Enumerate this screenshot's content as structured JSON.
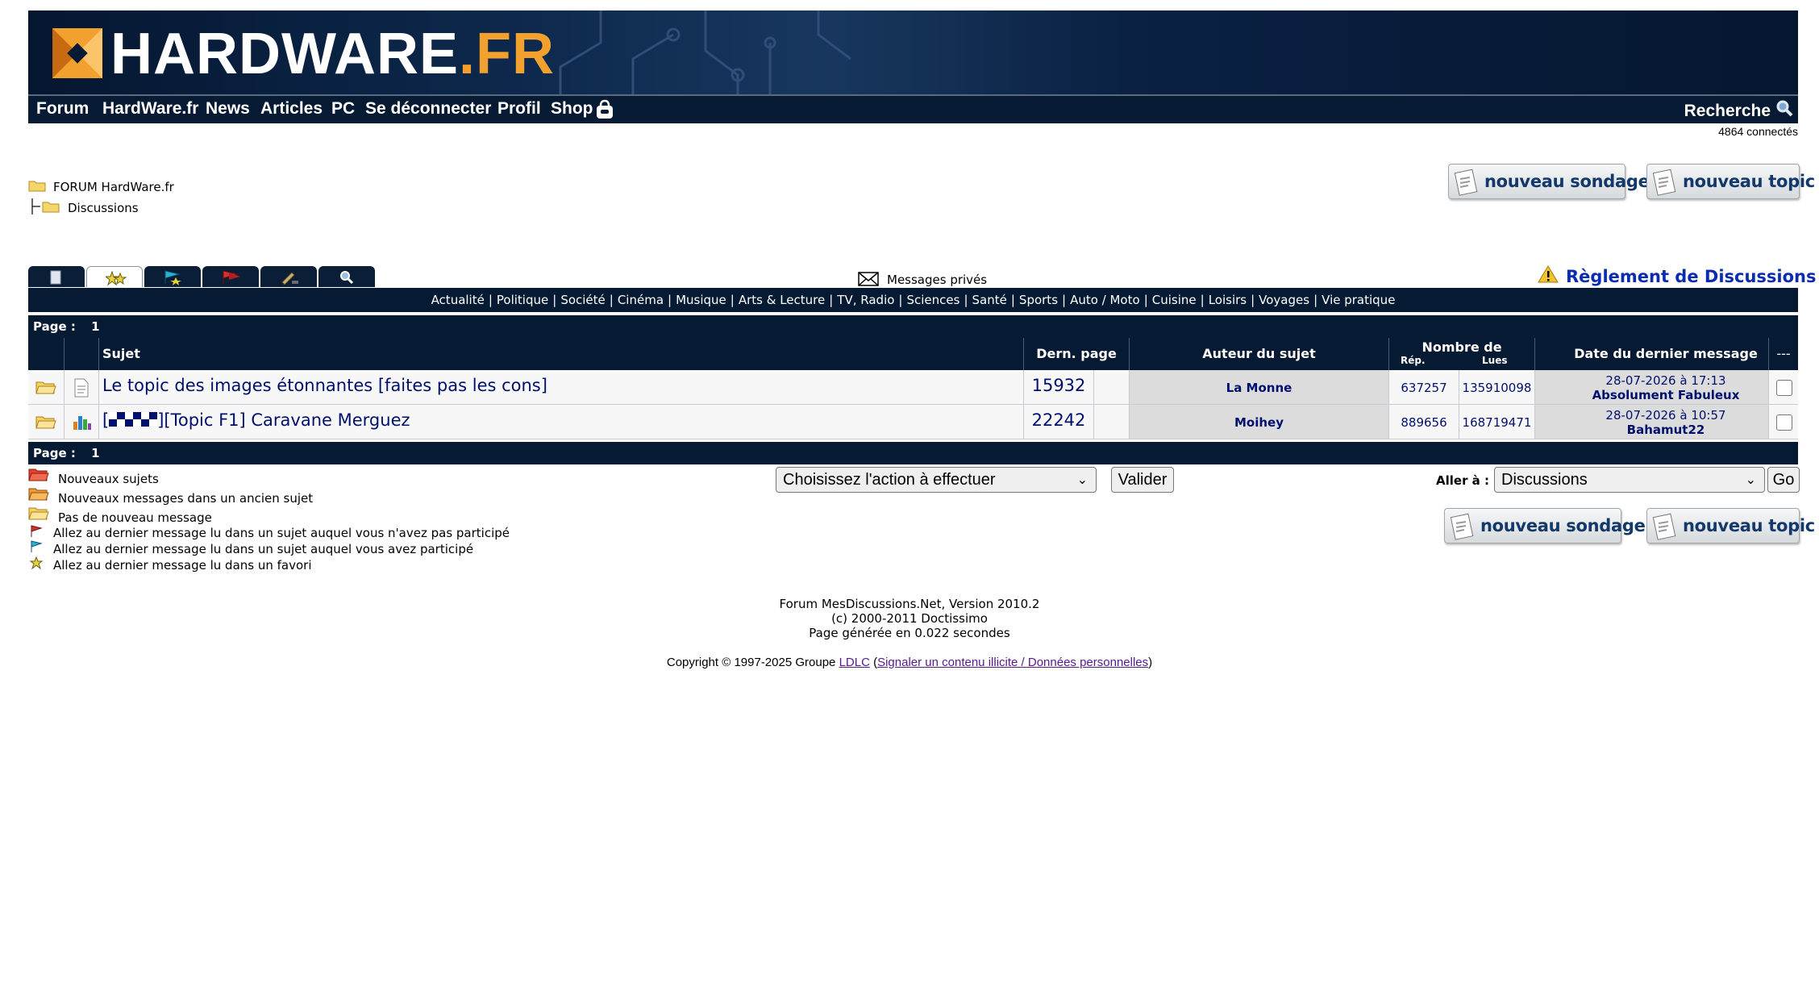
{
  "header": {
    "logo_main": "HARDWARE",
    "logo_suffix": ".FR",
    "nav": [
      "Forum",
      "HardWare.fr",
      "News",
      "Articles",
      "PC",
      "Se déconnecter",
      "Profil",
      "Shop"
    ],
    "search_label": "Recherche",
    "connected": "4864 connectés"
  },
  "breadcrumb": {
    "root": "FORUM HardWare.fr",
    "child": "Discussions"
  },
  "buttons": {
    "new_poll": "nouveau sondage",
    "new_topic": "nouveau topic"
  },
  "toolbar": {
    "private_messages": "Messages privés",
    "rules_link": "Règlement de Discussions",
    "tab_icons": [
      "page-icon",
      "stars-icon",
      "blue-flag-icon",
      "red-flag-icon",
      "pen-icon",
      "magnifier-icon"
    ]
  },
  "categories": [
    "Actualité",
    "Politique",
    "Société",
    "Cinéma",
    "Musique",
    "Arts & Lecture",
    "TV, Radio",
    "Sciences",
    "Santé",
    "Sports",
    "Auto / Moto",
    "Cuisine",
    "Loisirs",
    "Voyages",
    "Vie pratique"
  ],
  "pagination": {
    "label": "Page :",
    "current": "1"
  },
  "table": {
    "headers": {
      "subject": "Sujet",
      "last_page": "Dern. page",
      "author": "Auteur du sujet",
      "count": "Nombre de",
      "replies": "Rép.",
      "reads": "Lues",
      "last_msg": "Date du dernier message",
      "select": "---"
    },
    "rows": [
      {
        "prefix": "",
        "title": "Le topic des images étonnantes [faites pas les cons]",
        "last_page": "15932",
        "author": "La Monne",
        "replies": "637257",
        "reads": "135910098",
        "last_date": "28-07-2026 à 17:13",
        "last_author": "Absolument Fabuleux",
        "type_icon": "document-icon"
      },
      {
        "prefix": "[",
        "suffix": "][Topic F1] Caravane Merguez",
        "title": "[][Topic F1] Caravane Merguez",
        "last_page": "22242",
        "author": "Moihey",
        "replies": "889656",
        "reads": "168719471",
        "last_date": "28-07-2026 à 10:57",
        "last_author": "Bahamut22",
        "type_icon": "poll-chart-icon"
      }
    ]
  },
  "legend": [
    "Nouveaux sujets",
    "Nouveaux messages dans un ancien sujet",
    "Pas de nouveau message",
    "Allez au dernier message lu dans un sujet auquel vous n'avez pas participé",
    "Allez au dernier message lu dans un sujet auquel vous avez participé",
    "Allez au dernier message lu dans un favori"
  ],
  "actions": {
    "select_value": "Choisissez l'action à effectuer",
    "validate": "Valider",
    "goto_label": "Aller à :",
    "goto_value": "Discussions",
    "go": "Go"
  },
  "footer": {
    "line1": "Forum MesDiscussions.Net, Version 2010.2",
    "line2": "(c) 2000-2011 Doctissimo",
    "line3": "Page générée en 0.022 secondes",
    "copyright_prefix": "Copyright © 1997-2025 Groupe",
    "ldlc": "LDLC",
    "report_link": "Signaler un contenu illicite / Données personnelles"
  },
  "colors": {
    "header_bg": "#061a33",
    "logo_orange": "#f2a12e",
    "link_blue": "#00106e",
    "rules_blue": "#0a2cb0"
  }
}
